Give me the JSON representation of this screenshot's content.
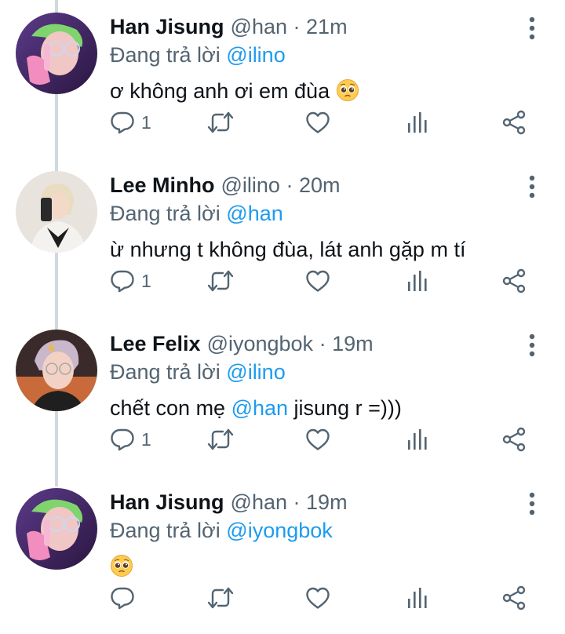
{
  "labels": {
    "replying_to": "Đang trả lời",
    "separator": "·"
  },
  "tweets": [
    {
      "name": "Han Jisung",
      "handle": "@han",
      "time": "21m",
      "reply_to": "@ilino",
      "text": "ơ không anh ơi em đùa",
      "text_mention": "",
      "text_after": "",
      "emoji": "pleading-face-emoji",
      "reply_count": "1",
      "avatar": "han-avatar"
    },
    {
      "name": "Lee Minho",
      "handle": "@ilino",
      "time": "20m",
      "reply_to": "@han",
      "text": "ừ nhưng t không đùa, lát anh gặp m tí",
      "text_mention": "",
      "text_after": "",
      "emoji": "",
      "reply_count": "1",
      "avatar": "minho-avatar"
    },
    {
      "name": "Lee Felix",
      "handle": "@iyongbok",
      "time": "19m",
      "reply_to": "@ilino",
      "text": "chết con mẹ ",
      "text_mention": "@han",
      "text_after": " jisung r =)))",
      "emoji": "",
      "reply_count": "1",
      "avatar": "felix-avatar"
    },
    {
      "name": "Han Jisung",
      "handle": "@han",
      "time": "19m",
      "reply_to": "@iyongbok",
      "text": "",
      "text_mention": "",
      "text_after": "",
      "emoji": "pleading-face-emoji",
      "reply_count": "",
      "avatar": "han-avatar"
    }
  ],
  "icons": [
    "reply-icon",
    "retweet-icon",
    "like-icon",
    "views-icon",
    "share-icon",
    "more-icon"
  ],
  "colors": {
    "accent": "#1d9bf0",
    "muted": "#536471",
    "text": "#0f1419",
    "thread_line": "#cfd9de"
  }
}
